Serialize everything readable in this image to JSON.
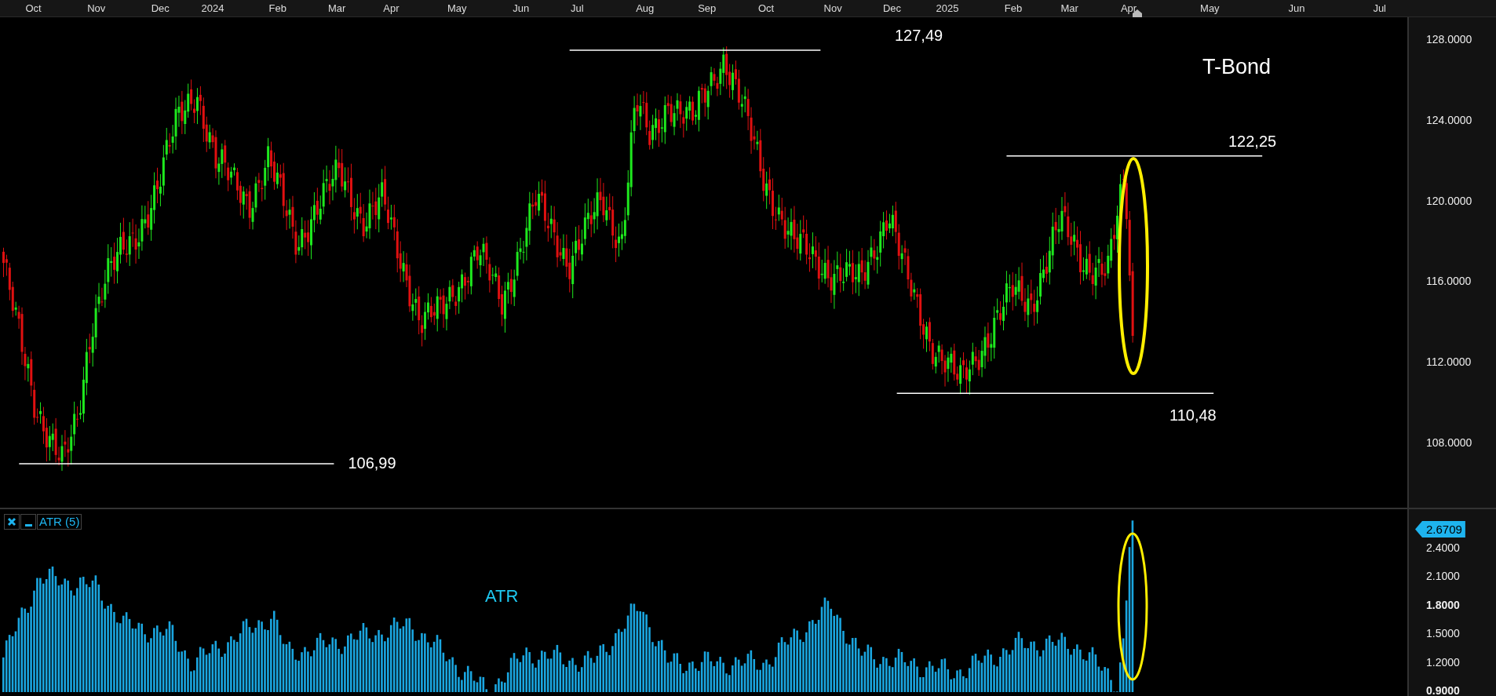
{
  "time_axis": {
    "labels": [
      "Oct",
      "Nov",
      "Dec",
      "2024",
      "Feb",
      "Mar",
      "Apr",
      "May",
      "Jun",
      "Jul",
      "Aug",
      "Sep",
      "Oct",
      "Nov",
      "Dec",
      "2025",
      "Feb",
      "Mar",
      "Apr",
      "May",
      "Jun",
      "Jul"
    ]
  },
  "price_chart": {
    "title": "T-Bond",
    "axis_labels": [
      "128.0000",
      "124.0000",
      "120.0000",
      "116.0000",
      "112.0000",
      "108.0000"
    ],
    "levels": [
      {
        "label": "127,49"
      },
      {
        "label": "122,25"
      },
      {
        "label": "110,48"
      },
      {
        "label": "106,99"
      }
    ]
  },
  "indicator": {
    "name": "ATR (5)",
    "label": "ATR",
    "current_value": "2.6709",
    "axis_labels": [
      {
        "text": "2.4000",
        "bold": false
      },
      {
        "text": "2.1000",
        "bold": false
      },
      {
        "text": "1.8000",
        "bold": true
      },
      {
        "text": "1.5000",
        "bold": false
      },
      {
        "text": "1.2000",
        "bold": false
      },
      {
        "text": "0.9000",
        "bold": true
      }
    ]
  }
}
